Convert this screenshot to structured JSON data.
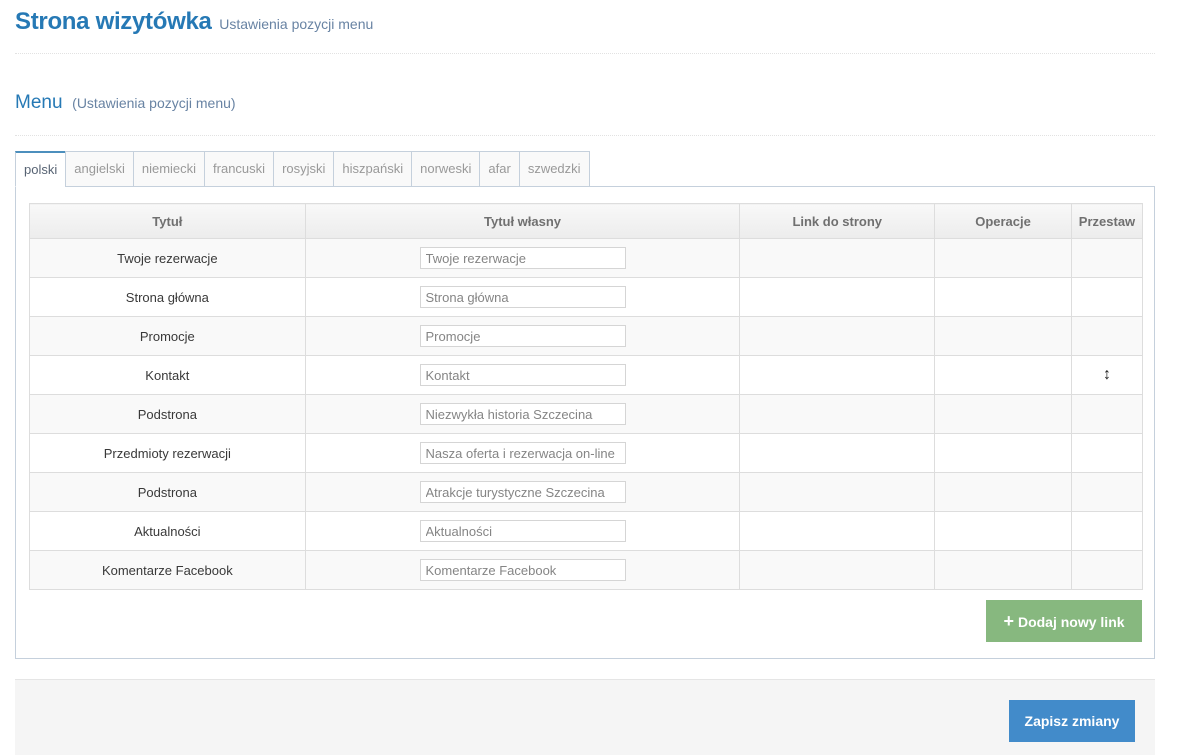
{
  "page": {
    "title": "Strona wizytówka",
    "subtitle": "Ustawienia pozycji menu"
  },
  "section": {
    "title": "Menu",
    "subtitle": "(Ustawienia pozycji menu)"
  },
  "tabs": [
    {
      "label": "polski",
      "active": true
    },
    {
      "label": "angielski"
    },
    {
      "label": "niemiecki"
    },
    {
      "label": "francuski"
    },
    {
      "label": "rosyjski"
    },
    {
      "label": "hiszpański"
    },
    {
      "label": "norweski"
    },
    {
      "label": "afar"
    },
    {
      "label": "szwedzki"
    }
  ],
  "table": {
    "headers": {
      "title": "Tytuł",
      "custom_title": "Tytuł własny",
      "link": "Link do strony",
      "operations": "Operacje",
      "reorder": "Przestaw"
    },
    "rows": [
      {
        "title": "Twoje rezerwacje",
        "custom_title": "Twoje rezerwacje"
      },
      {
        "title": "Strona główna",
        "custom_title": "Strona główna"
      },
      {
        "title": "Promocje",
        "custom_title": "Promocje"
      },
      {
        "title": "Kontakt",
        "custom_title": "Kontakt",
        "drag_icon": "↕"
      },
      {
        "title": "Podstrona",
        "custom_title": "Niezwykła historia Szczecina"
      },
      {
        "title": "Przedmioty rezerwacji",
        "custom_title": "Nasza oferta i rezerwacja on-line"
      },
      {
        "title": "Podstrona",
        "custom_title": "Atrakcje turystyczne Szczecina"
      },
      {
        "title": "Aktualności",
        "custom_title": "Aktualności"
      },
      {
        "title": "Komentarze Facebook",
        "custom_title": "Komentarze Facebook"
      }
    ]
  },
  "buttons": {
    "add_plus": "+",
    "add_link": "Dodaj nowy link",
    "save": "Zapisz zmiany"
  },
  "icons": {
    "add": "plus-icon",
    "reorder": "arrows-vertical-icon"
  },
  "colors": {
    "brand_blue": "#2679b5",
    "add_green": "#87b87f",
    "save_blue": "#428bca"
  }
}
